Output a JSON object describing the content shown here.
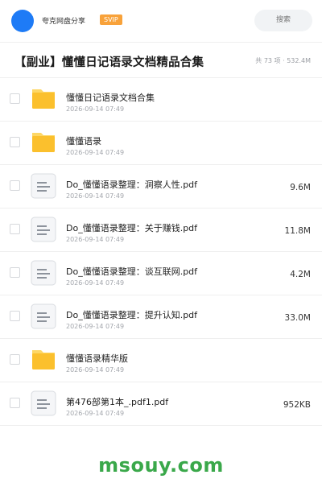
{
  "account": {
    "name": "夸克网盘分享",
    "badge": "SVIP"
  },
  "search": {
    "placeholder": "搜索"
  },
  "folder": {
    "title": "【副业】懂懂日记语录文档精品合集",
    "meta": "共 73 项 · 532.4M"
  },
  "files": [
    {
      "type": "folder-icon",
      "name": "懂懂日记语录文档合集",
      "date": "2026-09-14 07:49",
      "size": ""
    },
    {
      "type": "folder-icon",
      "name": "懂懂语录",
      "date": "2026-09-14 07:49",
      "size": ""
    },
    {
      "type": "document-icon",
      "name": "Do_懂懂语录整理：洞察人性.pdf",
      "date": "2026-09-14 07:49",
      "size": "9.6M"
    },
    {
      "type": "document-icon",
      "name": "Do_懂懂语录整理：关于赚钱.pdf",
      "date": "2026-09-14 07:49",
      "size": "11.8M"
    },
    {
      "type": "document-icon",
      "name": "Do_懂懂语录整理：谈互联网.pdf",
      "date": "2026-09-14 07:49",
      "size": "4.2M"
    },
    {
      "type": "document-icon",
      "name": "Do_懂懂语录整理：提升认知.pdf",
      "date": "2026-09-14 07:49",
      "size": "33.0M"
    },
    {
      "type": "folder-icon",
      "name": "懂懂语录精华版",
      "date": "2026-09-14 07:49",
      "size": ""
    },
    {
      "type": "document-icon",
      "name": "第476部第1本_.pdf1.pdf",
      "date": "2026-09-14 07:49",
      "size": "952KB"
    }
  ],
  "watermark": "msouy.com",
  "colors": {
    "accent": "#1e7bf6",
    "svip": "#f8a23a",
    "folder": "#fbc02d",
    "watermark": "#3aa84a"
  }
}
